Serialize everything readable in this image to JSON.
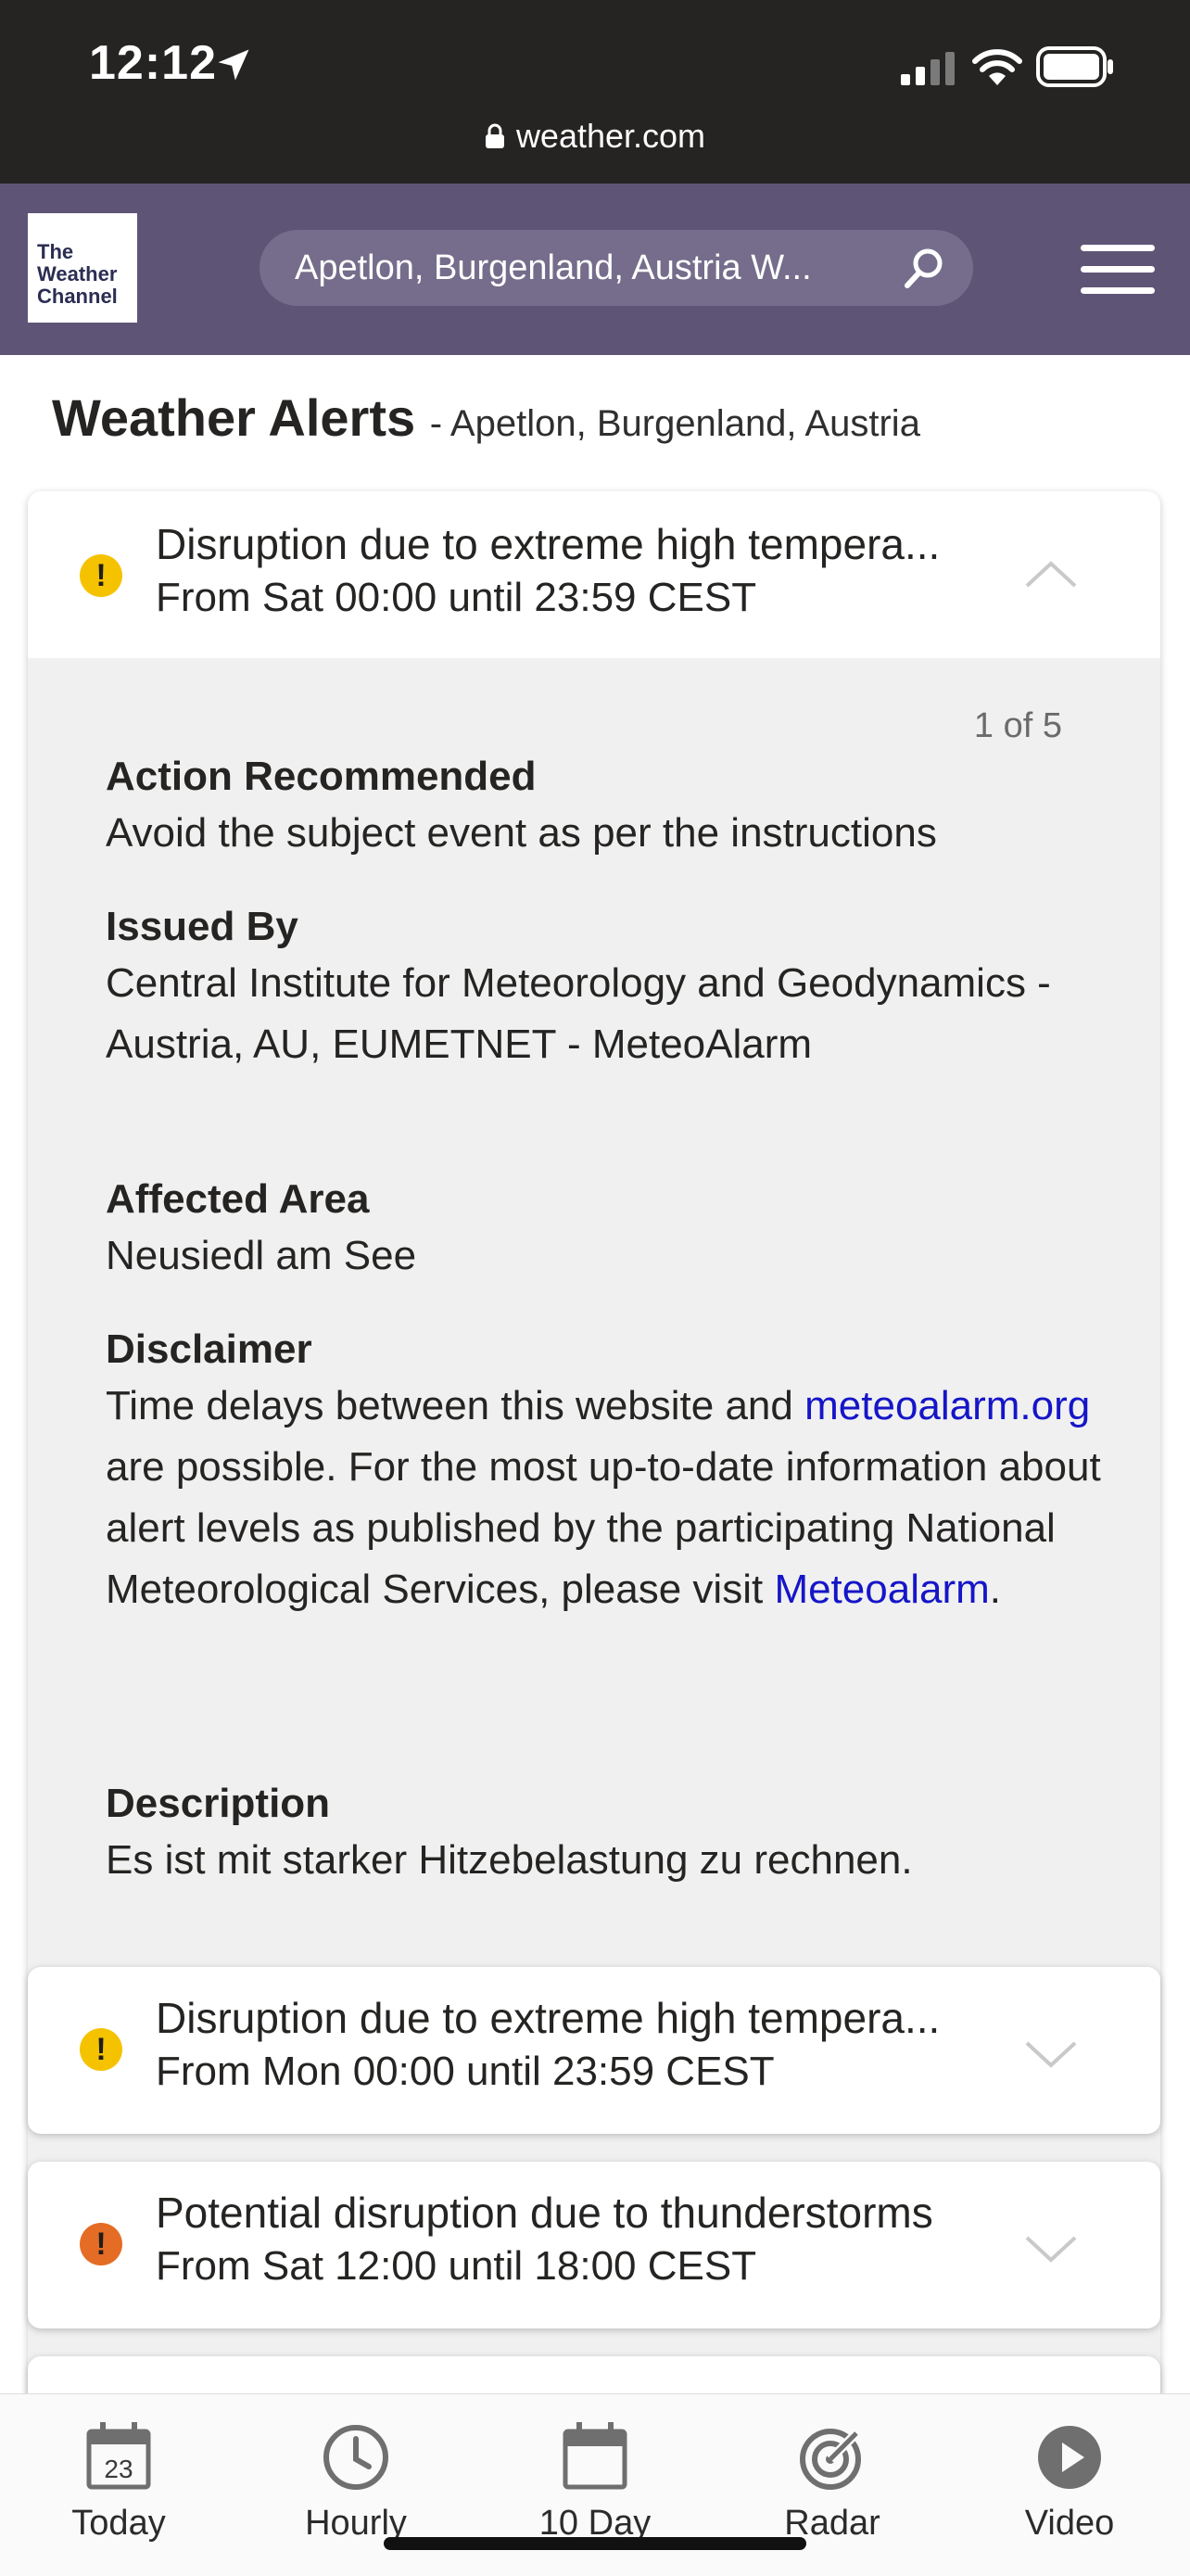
{
  "status_bar": {
    "time": "12:12",
    "url": "weather.com"
  },
  "header": {
    "logo_lines": [
      "The",
      "Weather",
      "Channel"
    ],
    "search_value": "Apetlon, Burgenland, Austria W..."
  },
  "page": {
    "title": "Weather Alerts",
    "subtitle": "- Apetlon, Burgenland, Austria"
  },
  "alerts": [
    {
      "title": "Disruption due to extreme high tempera...",
      "time": "From Sat 00:00 until 23:59 CEST",
      "severity_color": "#f5c200",
      "expanded": true,
      "counter": "1 of 5",
      "action_label": "Action Recommended",
      "action_text": "Avoid the subject event as per the instructions",
      "issued_label": "Issued By",
      "issued_text": "Central Institute for Meteorology and Geodynamics - Austria, AU, EUMETNET - MeteoAlarm",
      "area_label": "Affected Area",
      "area_text": "Neusiedl am See",
      "disclaimer_label": "Disclaimer",
      "disclaimer_text_1": "Time delays between this website and",
      "disclaimer_link_1": "meteoalarm.org",
      "disclaimer_text_2": "are possible. For the most up-to-date information about alert levels as published by the participating National Meteorological Services, please visit",
      "disclaimer_link_2": "Meteoalarm",
      "disclaimer_end": ".",
      "description_label": "Description",
      "description_text": "Es ist mit starker Hitzebelastung zu rechnen."
    },
    {
      "title": "Disruption due to extreme high tempera...",
      "time": "From Mon 00:00 until 23:59 CEST",
      "severity_color": "#f5c200",
      "expanded": false
    },
    {
      "title": "Potential disruption due to thunderstorms",
      "time": "From Sat 12:00 until 18:00 CEST",
      "severity_color": "#e46c24",
      "expanded": false
    }
  ],
  "bottom_nav": {
    "items": [
      {
        "label": "Today",
        "icon": "calendar-today-icon",
        "day": "23"
      },
      {
        "label": "Hourly",
        "icon": "clock-icon"
      },
      {
        "label": "10 Day",
        "icon": "calendar-icon"
      },
      {
        "label": "Radar",
        "icon": "radar-icon"
      },
      {
        "label": "Video",
        "icon": "play-icon"
      }
    ]
  }
}
